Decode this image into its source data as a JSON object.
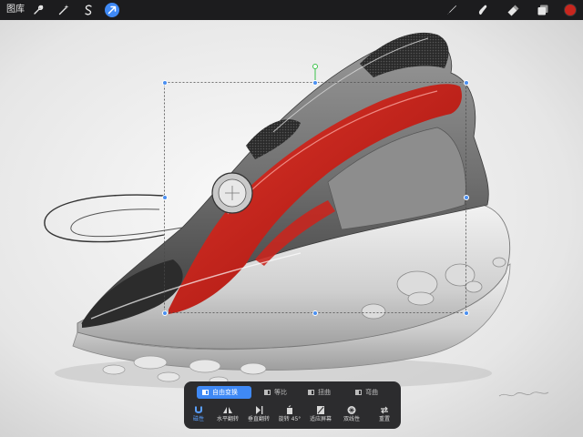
{
  "topbar": {
    "gallery_label": "图库",
    "left_tools": [
      {
        "name": "actions",
        "icon": "wrench-icon",
        "active": false
      },
      {
        "name": "adjustments",
        "icon": "magic-wand-icon",
        "active": false
      },
      {
        "name": "selection",
        "icon": "selection-s-icon",
        "active": false
      },
      {
        "name": "transform",
        "icon": "arrow-cursor-icon",
        "active": true
      }
    ],
    "right_tools": [
      {
        "name": "brush",
        "icon": "brush-icon"
      },
      {
        "name": "smudge",
        "icon": "smudge-icon"
      },
      {
        "name": "eraser",
        "icon": "eraser-icon"
      },
      {
        "name": "layers",
        "icon": "layers-icon"
      },
      {
        "name": "color",
        "icon": "color-swatch-icon",
        "color": "#c8261e"
      }
    ],
    "accent_color": "#3f89f5"
  },
  "transform_bar": {
    "modes": [
      {
        "label": "自由变换",
        "selected": true
      },
      {
        "label": "等比",
        "selected": false
      },
      {
        "label": "扭曲",
        "selected": false
      },
      {
        "label": "弯曲",
        "selected": false
      }
    ],
    "tools": [
      {
        "label": "磁性",
        "icon": "magnet-icon",
        "active": true
      },
      {
        "label": "水平翻转",
        "icon": "flip-horizontal-icon",
        "active": false
      },
      {
        "label": "垂直翻转",
        "icon": "flip-vertical-icon",
        "active": false
      },
      {
        "label": "旋转 45°",
        "icon": "rotate-45-icon",
        "active": false
      },
      {
        "label": "适应屏幕",
        "icon": "fit-screen-icon",
        "active": false
      },
      {
        "label": "双线性",
        "icon": "bilinear-icon",
        "active": false
      },
      {
        "label": "重置",
        "icon": "reset-icon",
        "active": false
      }
    ]
  },
  "canvas": {
    "subject": "sneaker sketch",
    "colors": {
      "accent_red": "#c8261e",
      "dark": "#2a2a2a",
      "sole": "#d8d8d8"
    }
  }
}
